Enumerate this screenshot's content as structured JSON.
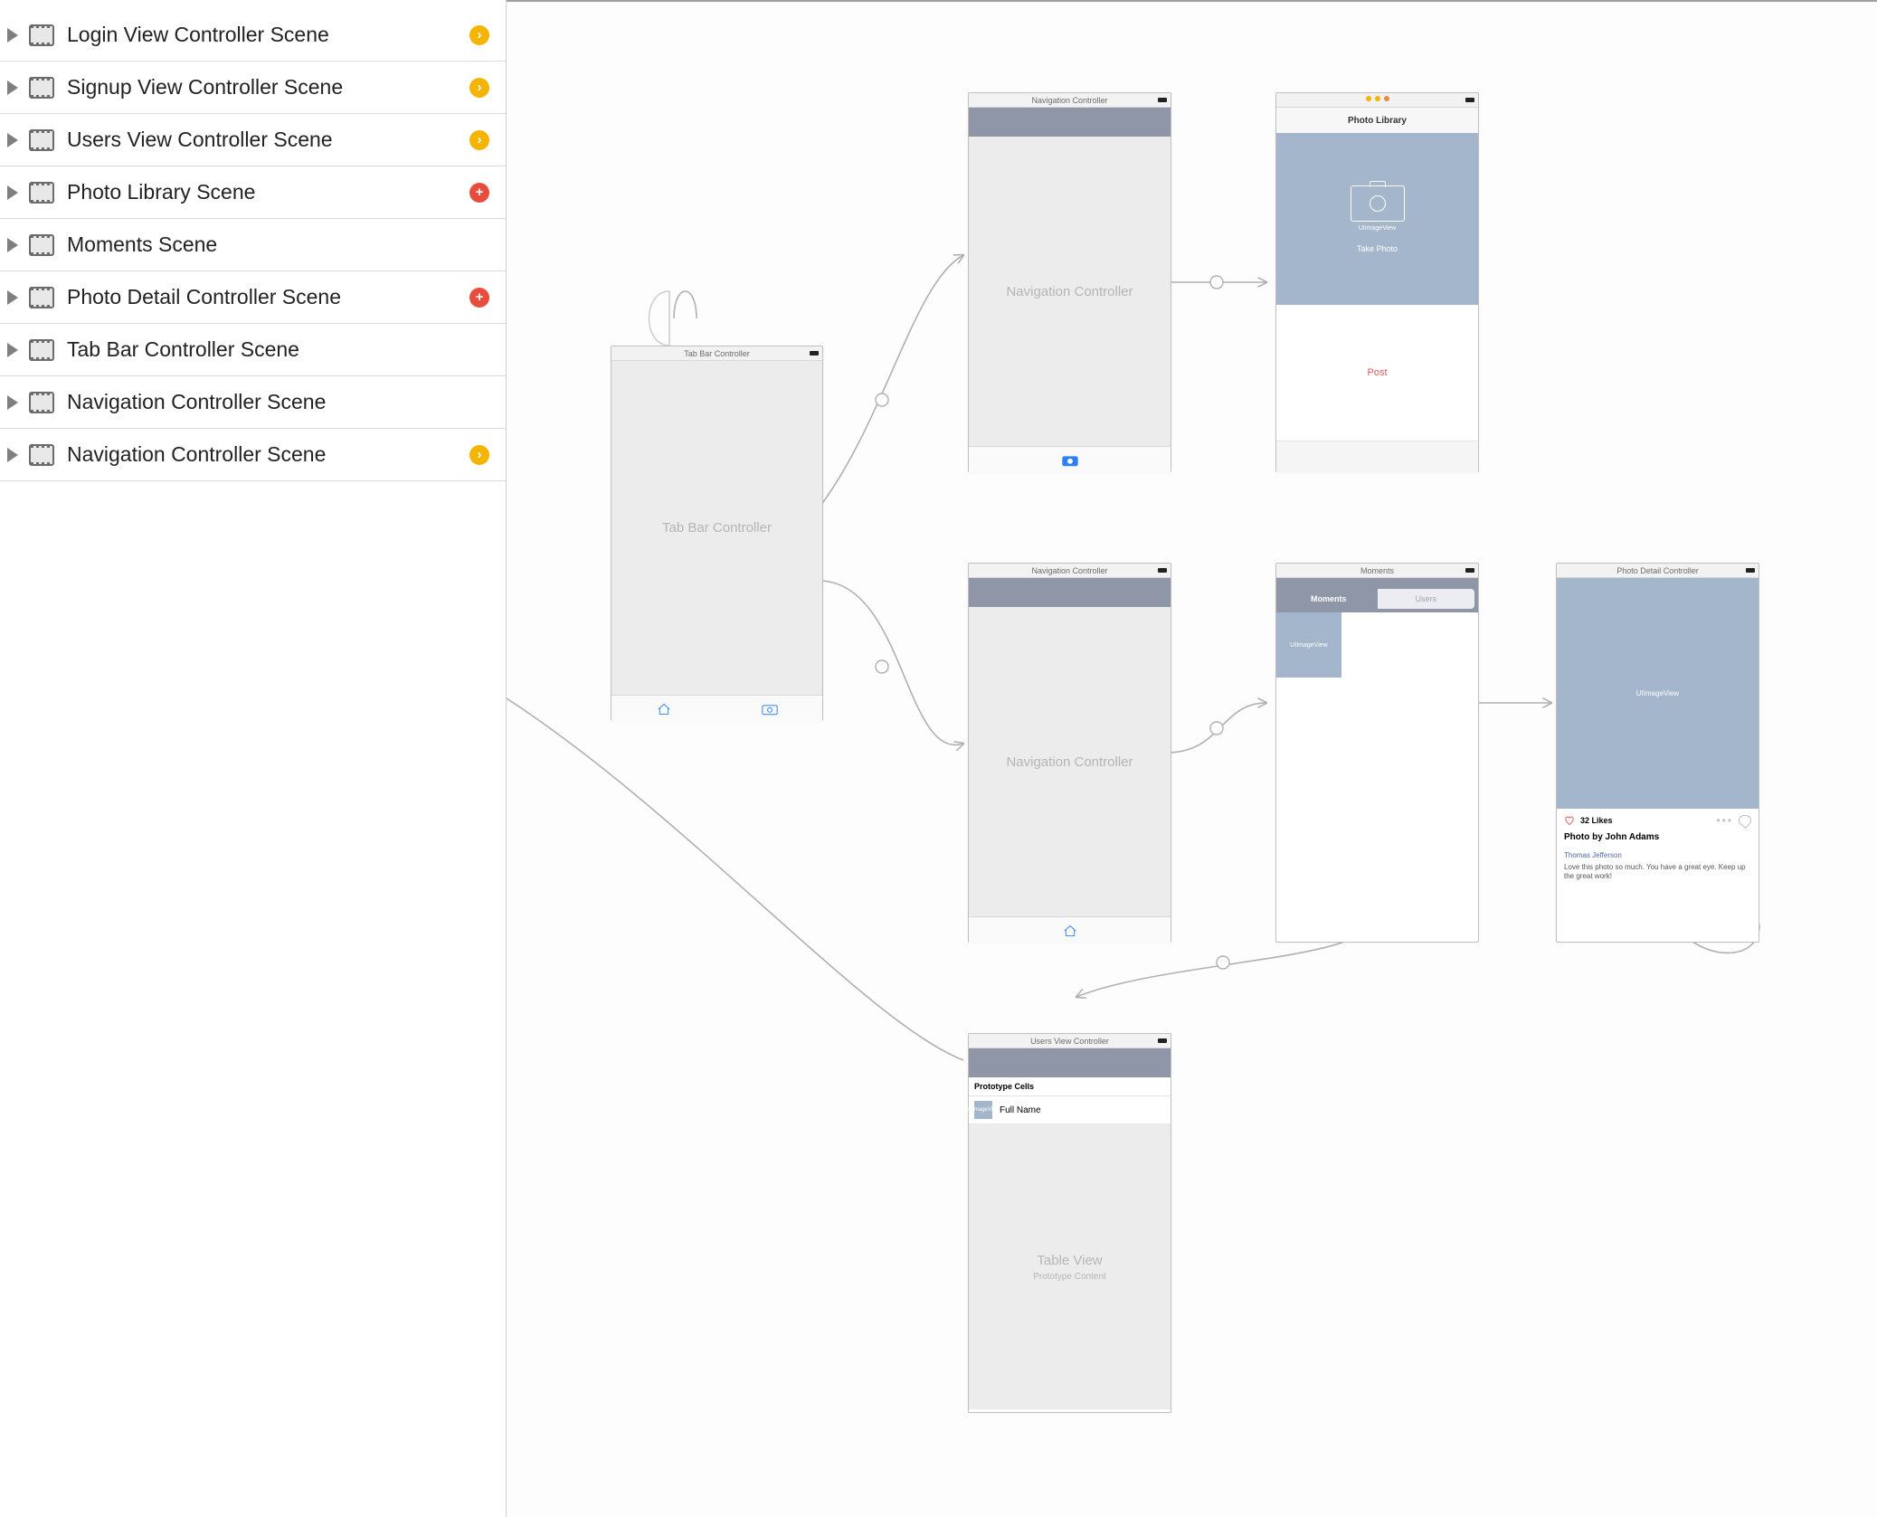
{
  "outline": {
    "items": [
      {
        "label": "Login View Controller Scene",
        "status": "yellow"
      },
      {
        "label": "Signup View Controller Scene",
        "status": "yellow"
      },
      {
        "label": "Users View Controller Scene",
        "status": "yellow"
      },
      {
        "label": "Photo Library Scene",
        "status": "red"
      },
      {
        "label": "Moments Scene",
        "status": null
      },
      {
        "label": "Photo Detail Controller Scene",
        "status": "red"
      },
      {
        "label": "Tab Bar Controller Scene",
        "status": null
      },
      {
        "label": "Navigation Controller Scene",
        "status": null
      },
      {
        "label": "Navigation Controller Scene",
        "status": "yellow"
      }
    ],
    "status_glyph": {
      "yellow": "›",
      "red": "+"
    }
  },
  "scenes": {
    "tabbar": {
      "title": "Tab Bar Controller",
      "body": "Tab Bar Controller"
    },
    "nav1": {
      "title": "Navigation Controller",
      "body": "Navigation Controller"
    },
    "nav2": {
      "title": "Navigation Controller",
      "body": "Navigation Controller"
    },
    "photoLib": {
      "title": "",
      "nav": "Photo Library",
      "placeholder": "UIImageView",
      "button": "Take Photo",
      "post": "Post"
    },
    "moments": {
      "title": "Moments",
      "seg_active": "Moments",
      "seg_inactive": "Users",
      "thumb": "UIImageView"
    },
    "usersVC": {
      "title": "Users View Controller",
      "proto_header": "Prototype Cells",
      "cell_label": "Full Name",
      "cell_thumb": "UIImageView",
      "body1": "Table View",
      "body2": "Prototype Content"
    },
    "photoDetail": {
      "title": "Photo Detail Controller",
      "placeholder": "UIImageView",
      "likes": "32 Likes",
      "heading": "Photo by John Adams",
      "commenter": "Thomas Jefferson",
      "comment": "Love this photo so much. You have a great eye. Keep up the great work!"
    }
  },
  "colors": {
    "highlight": "#a4b6cb",
    "nav": "#8e96a8",
    "link": "#2f80f6",
    "red": "#e05a5a"
  }
}
